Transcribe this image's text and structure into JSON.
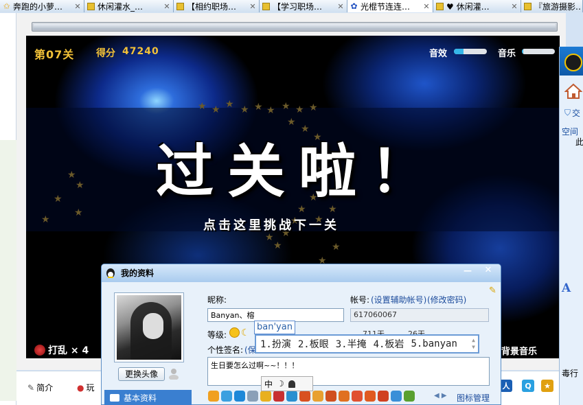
{
  "browser": {
    "tabs": [
      {
        "title": "奔跑的小萝…",
        "active": false,
        "icon": "star-icon"
      },
      {
        "title": "休闲灌水_…",
        "active": false,
        "icon": "bookmark-icon"
      },
      {
        "title": "【相约职场…",
        "active": false,
        "icon": "bookmark-icon"
      },
      {
        "title": "【学习职场…",
        "active": false,
        "icon": "bookmark-icon"
      },
      {
        "title": "光棍节连连…",
        "active": true,
        "icon": "paw-icon"
      },
      {
        "title": "♥ 休闲灌…",
        "active": false,
        "icon": "bookmark-icon"
      },
      {
        "title": "『旅游摄影…",
        "active": false,
        "icon": "bookmark-icon"
      }
    ],
    "close_glyph": "✕"
  },
  "game": {
    "level_label": "第07关",
    "score_label": "得分",
    "score_value": "47240",
    "sfx_label": "音效",
    "sfx_level": 0.3,
    "music_label": "音乐",
    "music_level": 0.05,
    "cleared_text": "过关啦！",
    "next_level_text": "点击这里挑战下一关",
    "shuffle_text": "打乱 × 4",
    "bg_music_text": "背景音乐",
    "loading_progress": 1.0
  },
  "page_nav": {
    "intro_label": "简介",
    "play_label": "玩"
  },
  "qq_panel": {
    "item1": "交",
    "item2": "空间",
    "item3": "此",
    "font_glyph": "A",
    "cut_text": "毒行"
  },
  "profile_dialog": {
    "title": "我的资料",
    "min_glyph": "—",
    "close_glyph": "✕",
    "change_avatar_label": "更换头像",
    "nav_basic_label": "基本资料",
    "nickname_label": "昵称:",
    "nickname_value": "Banyan、榕",
    "account_label": "帐号:",
    "set_aux_link": "(设置辅助帐号)",
    "change_pwd_link": "(修改密码)",
    "account_value": "617060067",
    "level_label": "等级:",
    "days_1": "711天",
    "days_2": "26天",
    "signature_label": "个性签名:",
    "signature_link": "(保",
    "signature_value": "生日要怎么过啊~~！！！",
    "icon_manager_label": "图标管理",
    "arrows": "◀ ▶"
  },
  "ime": {
    "composition": "ban'yan",
    "candidates": [
      "1.扮演",
      "2.板眼",
      "3.半掩",
      "4.板岩",
      "5.banyan"
    ],
    "mode": "中",
    "moon": "☽"
  },
  "colors": {
    "accent_blue": "#3a7fd0",
    "score_gold": "#f3c238",
    "link_blue": "#1c4c9c"
  }
}
